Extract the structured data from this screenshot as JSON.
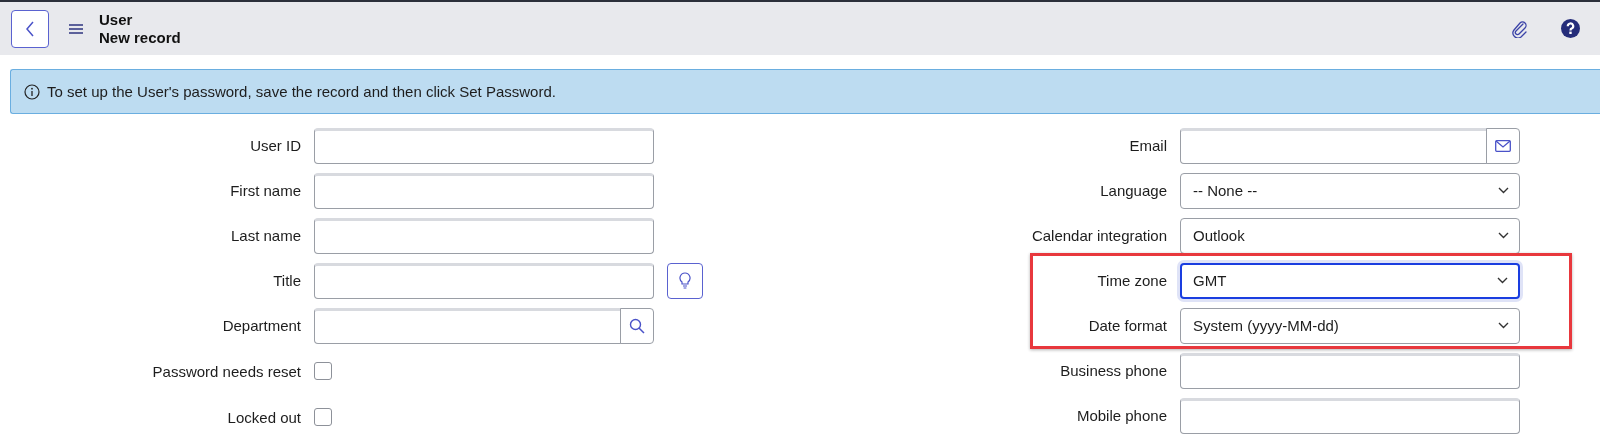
{
  "header": {
    "title": "User",
    "subtitle": "New record"
  },
  "info_message": "To set up the User's password, save the record and then click Set Password.",
  "left_fields": [
    {
      "label": "User ID",
      "kind": "text"
    },
    {
      "label": "First name",
      "kind": "text"
    },
    {
      "label": "Last name",
      "kind": "text"
    },
    {
      "label": "Title",
      "kind": "suggest"
    },
    {
      "label": "Department",
      "kind": "lookup"
    },
    {
      "label": "Password needs reset",
      "kind": "checkbox",
      "checked": false
    },
    {
      "label": "Locked out",
      "kind": "checkbox",
      "checked": false
    }
  ],
  "right_fields": [
    {
      "label": "Email",
      "kind": "email",
      "highlighted": false
    },
    {
      "label": "Language",
      "kind": "select",
      "value": "-- None --",
      "focused": false,
      "highlighted": false
    },
    {
      "label": "Calendar integration",
      "kind": "select",
      "value": "Outlook",
      "focused": false,
      "highlighted": false
    },
    {
      "label": "Time zone",
      "kind": "select",
      "value": "GMT",
      "focused": true,
      "highlighted": true
    },
    {
      "label": "Date format",
      "kind": "select",
      "value": "System (yyyy-MM-dd)",
      "focused": false,
      "highlighted": true
    },
    {
      "label": "Business phone",
      "kind": "text",
      "highlighted": false
    },
    {
      "label": "Mobile phone",
      "kind": "text",
      "highlighted": false
    }
  ]
}
